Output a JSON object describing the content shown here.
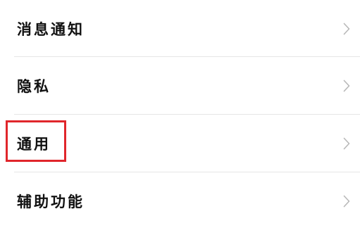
{
  "settings_list": {
    "items": [
      {
        "label": "消息通知",
        "icon": "chevron-right-icon"
      },
      {
        "label": "隐私",
        "icon": "chevron-right-icon"
      },
      {
        "label": "通用",
        "icon": "chevron-right-icon"
      },
      {
        "label": "辅助功能",
        "icon": "chevron-right-icon"
      }
    ]
  },
  "colors": {
    "highlight_border": "#e0262b",
    "divider": "#e6e6e6",
    "chevron": "#b8b8b8",
    "text": "#111111"
  }
}
